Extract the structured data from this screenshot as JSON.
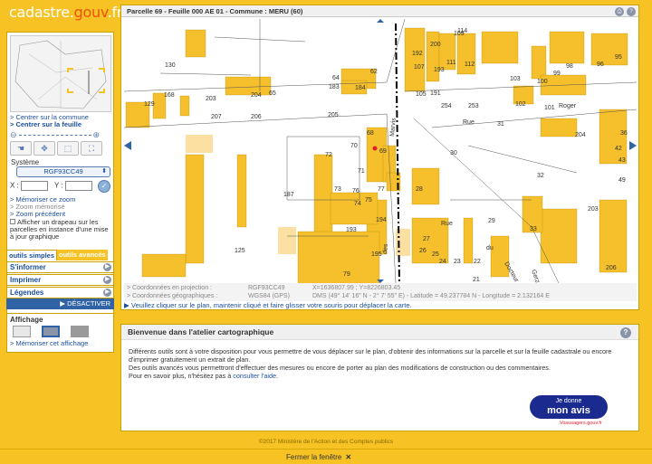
{
  "site": {
    "logo_main": "cadastre.",
    "logo_accent": "gouv",
    "logo_end": ".fr"
  },
  "left": {
    "center_commune": "> Centrer sur la commune",
    "center_feuille": "> Centrer sur la feuille",
    "systeme_label": "Système",
    "systeme_value": "RGF93CC49",
    "x_label": "X :",
    "y_label": "Y :",
    "memoriser_zoom": "> Mémoriser ce zoom",
    "zoom_memorise": "> Zoom mémorisé",
    "zoom_precedent": "> Zoom précédent",
    "flag_text": "Afficher un drapeau sur les parcelles en instance d'une mise à jour graphique",
    "tab_simple": "outils simples",
    "tab_advanced": "outils avancés",
    "tools": [
      "S'informer",
      "Imprimer",
      "Légendes"
    ],
    "deactivate": "▶ DÉSACTIVER",
    "display_title": "Affichage",
    "memoriser_affichage": "> Mémoriser cet affichage"
  },
  "map": {
    "title": "Parcelle 69 - Feuille 000 AE 01 - Commune : MERU (60)",
    "coords_proj_label": "> Coordonnées en projection :",
    "coords_proj_sys": "RGF93CC49",
    "coords_proj_val": "X=1636807.99 ; Y=8226803.45",
    "coords_geo_label": "> Coordonnées géographiques :",
    "coords_geo_sys": "WGS84 (GPS)",
    "coords_geo_val": "DMS (49° 14' 16\" N - 2° 7' 55\" E) - Latitude = 49.237784 N - Longitude = 2.132164 E",
    "hint": "▶ Veuillez cliquer sur le plan, maintenir cliqué et faire glisser votre souris pour déplacer la carte.",
    "labels": [
      "130",
      "203",
      "204",
      "65",
      "205",
      "64",
      "62",
      "183",
      "168",
      "129",
      "178",
      "207",
      "206",
      "184",
      "72",
      "70",
      "71",
      "68",
      "69",
      "187",
      "73",
      "76",
      "77",
      "75",
      "74",
      "194",
      "193",
      "125",
      "195",
      "79",
      "192",
      "200",
      "109",
      "114",
      "107",
      "193",
      "111",
      "112",
      "103",
      "100",
      "99",
      "98",
      "96",
      "95",
      "105",
      "191",
      "254",
      "253",
      "102",
      "101",
      "31",
      "204",
      "36",
      "42",
      "43",
      "30",
      "28",
      "32",
      "49",
      "29",
      "203",
      "33",
      "27",
      "26",
      "25",
      "24",
      "23",
      "22",
      "21",
      "20",
      "206"
    ],
    "streets": [
      "Rue",
      "Marvis",
      "Roger",
      "Rue",
      "du",
      "Docteur",
      "Gerz",
      "des"
    ]
  },
  "welcome": {
    "title": "Bienvenue dans l'atelier cartographique",
    "p1": "Différents outils sont à votre disposition pour vous permettre de vous déplacer sur le plan, d'obtenir des informations sur la parcelle et sur la feuille cadastrale ou encore d'imprimer gratuitement un extrait de plan.",
    "p2": "Des outils avancés vous permettront d'effectuer des mesures ou encore de porter au plan des modifications de construction ou des commentaires.",
    "p3_pre": "Pour en savoir plus, n'hésitez pas à ",
    "p3_link": "consulter l'aide",
    "p3_post": ".",
    "avis_line1": "Je donne",
    "avis_line2": "mon avis",
    "avis_sub": "Vosusagers.gouv.fr"
  },
  "footer": {
    "copyright": "©2017 Ministère de l'Action et des Comptes publics",
    "close": "Fermer la fenêtre",
    "close_x": "✕"
  }
}
